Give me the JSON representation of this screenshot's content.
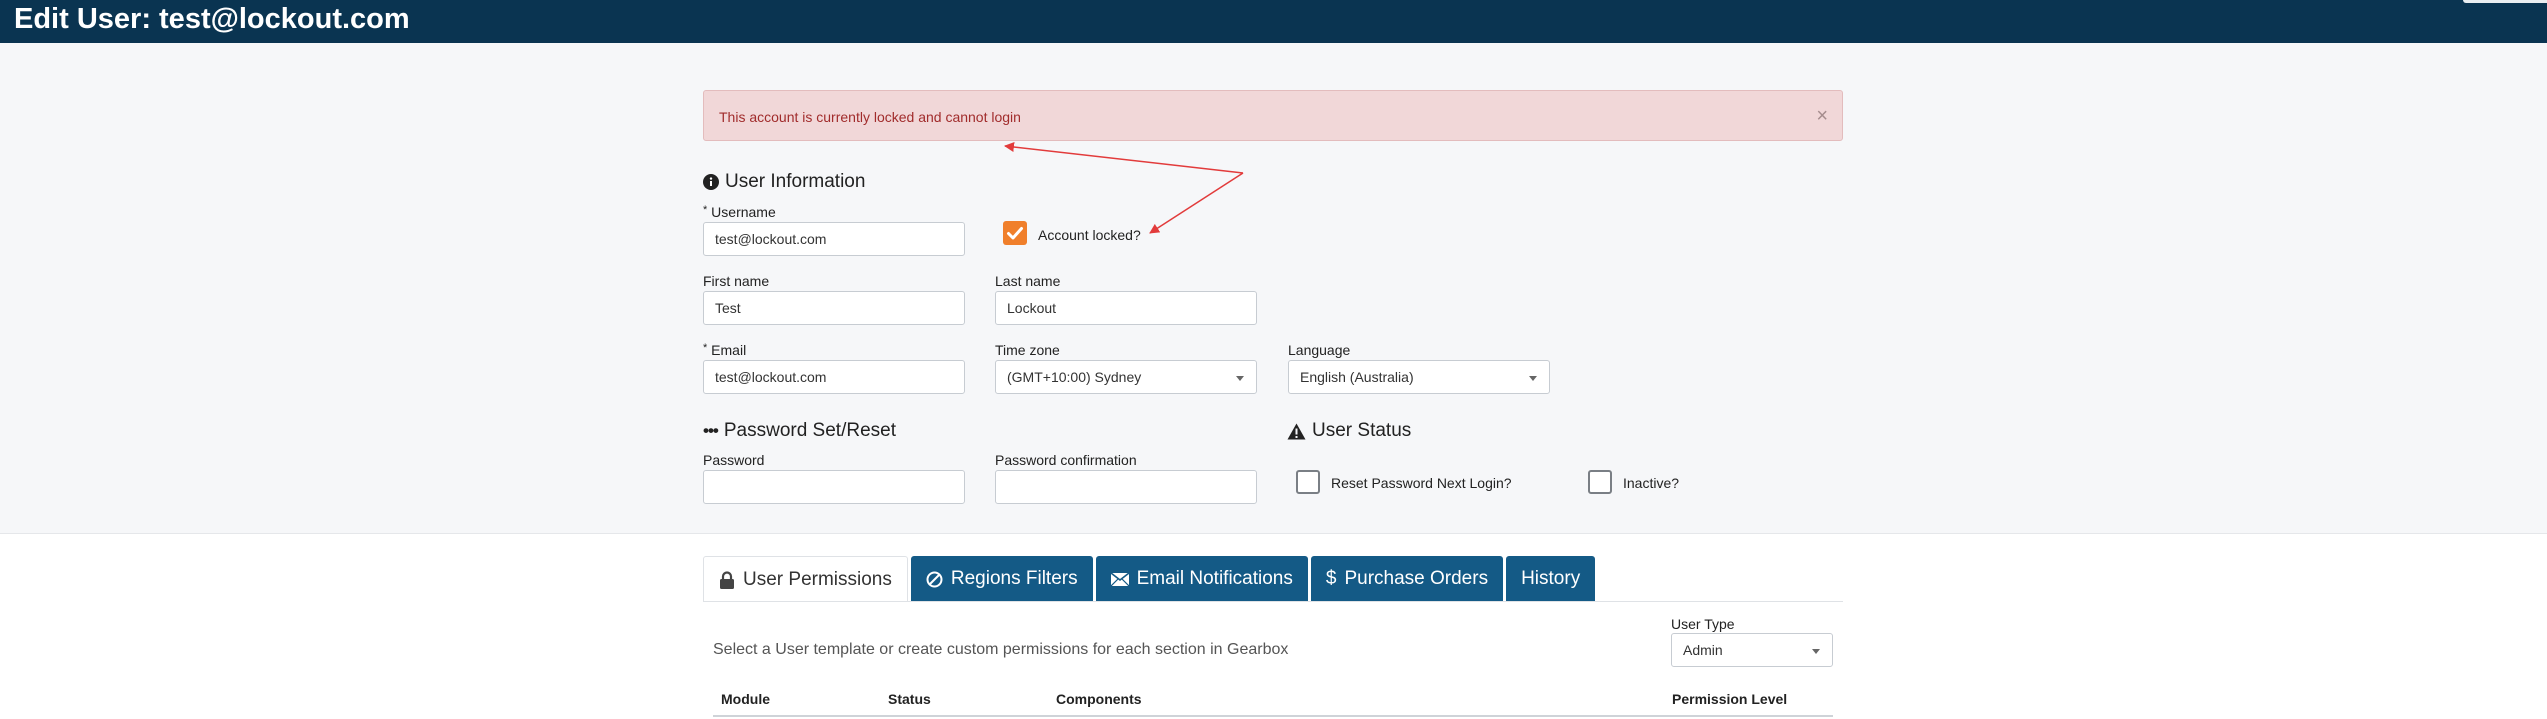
{
  "header": {
    "title": "Edit User: test@lockout.com"
  },
  "alert": {
    "message": "This account is currently locked and cannot login",
    "close": "×"
  },
  "user_info": {
    "title": "User Information",
    "username": {
      "label": "Username",
      "required": "*",
      "value": "test@lockout.com"
    },
    "account_locked": {
      "label": "Account locked?",
      "checked": true
    },
    "first_name": {
      "label": "First name",
      "value": "Test"
    },
    "last_name": {
      "label": "Last name",
      "value": "Lockout"
    },
    "email": {
      "label": "Email",
      "required": "*",
      "value": "test@lockout.com"
    },
    "time_zone": {
      "label": "Time zone",
      "value": "(GMT+10:00) Sydney"
    },
    "language": {
      "label": "Language",
      "value": "English (Australia)"
    }
  },
  "password": {
    "title": "Password Set/Reset",
    "icon": "•••",
    "password": {
      "label": "Password",
      "value": ""
    },
    "confirmation": {
      "label": "Password confirmation",
      "value": ""
    }
  },
  "user_status": {
    "title": "User Status",
    "reset_password": {
      "label": "Reset Password Next Login?",
      "checked": false
    },
    "inactive": {
      "label": "Inactive?",
      "checked": false
    }
  },
  "tabs": [
    {
      "label": "User Permissions",
      "icon": "lock-icon",
      "active": true
    },
    {
      "label": "Regions Filters",
      "icon": "ban-icon",
      "active": false
    },
    {
      "label": "Email Notifications",
      "icon": "envelope-icon",
      "active": false
    },
    {
      "label": "Purchase Orders",
      "icon": "dollar-icon",
      "glyph": "$",
      "active": false
    },
    {
      "label": "History",
      "icon": "",
      "active": false
    }
  ],
  "permissions": {
    "hint": "Select a User template or create custom permissions for each section in Gearbox",
    "user_type": {
      "label": "User Type",
      "value": "Admin"
    },
    "columns": [
      "Module",
      "Status",
      "Components",
      "Permission Level"
    ]
  },
  "colors": {
    "header": "#0a3451",
    "tab": "#145a86",
    "checkbox_on": "#f07f2b",
    "alert_text": "#a12c2c",
    "annotation": "#e23b3b"
  }
}
